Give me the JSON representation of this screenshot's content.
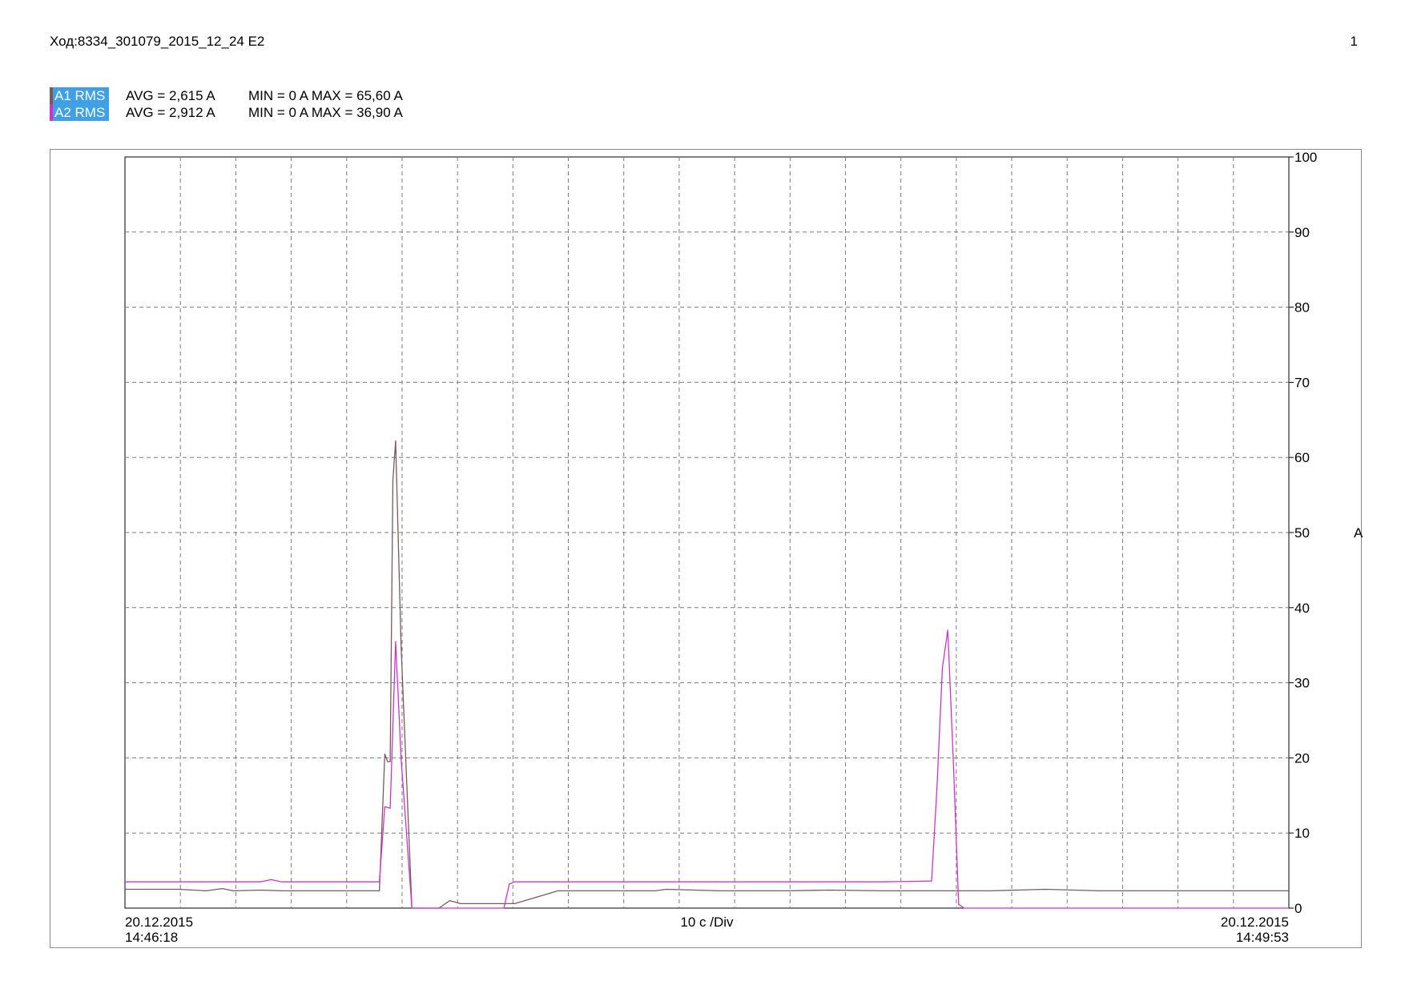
{
  "header": {
    "title": "Ход:8334_301079_2015_12_24 E2",
    "page_number": "1"
  },
  "legend": [
    {
      "label": "A1 RMS",
      "avg": "AVG = 2,615 A",
      "minmax": "MIN = 0 A MAX = 65,60 A",
      "color": "#7a5a5a"
    },
    {
      "label": "A2 RMS",
      "avg": "AVG = 2,912 A",
      "minmax": "MIN = 0 A MAX = 36,90 A",
      "color": "#cc33cc"
    }
  ],
  "chart_data": {
    "type": "line",
    "ylabel": "A",
    "ylim": [
      0,
      100
    ],
    "yticks": [
      0,
      10,
      20,
      30,
      40,
      50,
      60,
      70,
      80,
      90,
      100
    ],
    "xlim": [
      0,
      215
    ],
    "x_divisions": 21,
    "x_start_label": [
      "20.12.2015",
      "14:46:18"
    ],
    "x_end_label": [
      "20.12.2015",
      "14:49:53"
    ],
    "x_scale_label": "10 с /Div",
    "grid": true,
    "series": [
      {
        "name": "A1 RMS",
        "color": "#7a5a5a",
        "x": [
          0,
          10,
          15,
          18,
          20,
          25,
          29,
          30,
          40,
          47,
          48,
          48.5,
          49,
          49.5,
          50,
          51,
          53,
          53.5,
          54,
          56,
          58,
          60,
          62,
          64,
          66,
          70,
          72,
          80,
          90,
          96,
          98,
          100,
          110,
          115,
          120,
          122,
          130,
          140,
          150,
          151,
          152,
          152.5,
          153,
          153.5,
          154,
          155,
          160,
          170,
          180,
          190,
          200,
          215
        ],
        "values": [
          2.5,
          2.5,
          2.3,
          2.6,
          2.3,
          2.4,
          2.3,
          2.3,
          2.3,
          2.3,
          20.5,
          19.5,
          19.5,
          57,
          62.2,
          35,
          0,
          0,
          0,
          0,
          0,
          1,
          0.6,
          0.6,
          0.6,
          0.6,
          0.6,
          2.3,
          2.3,
          2.3,
          2.3,
          2.5,
          2.3,
          2.3,
          2.3,
          2.3,
          2.4,
          2.3,
          2.3,
          2.3,
          2.3,
          2.3,
          2.3,
          2.3,
          2.3,
          2.3,
          2.3,
          2.5,
          2.3,
          2.3,
          2.3,
          2.3
        ]
      },
      {
        "name": "A2 RMS",
        "color": "#cc33cc",
        "x": [
          0,
          10,
          25,
          27,
          29,
          30,
          40,
          47,
          48,
          49,
          50,
          51,
          53,
          66,
          70,
          71,
          72,
          74,
          90,
          110,
          130,
          140,
          149,
          150,
          151,
          152,
          153,
          154,
          155,
          170,
          200,
          215
        ],
        "values": [
          3.5,
          3.5,
          3.5,
          3.8,
          3.5,
          3.5,
          3.5,
          3.5,
          13.5,
          13.3,
          35.5,
          20,
          0,
          0,
          0,
          3.2,
          3.5,
          3.5,
          3.5,
          3.5,
          3.5,
          3.5,
          3.6,
          16,
          32,
          37,
          20,
          0.5,
          0,
          0,
          0,
          0
        ]
      }
    ]
  }
}
